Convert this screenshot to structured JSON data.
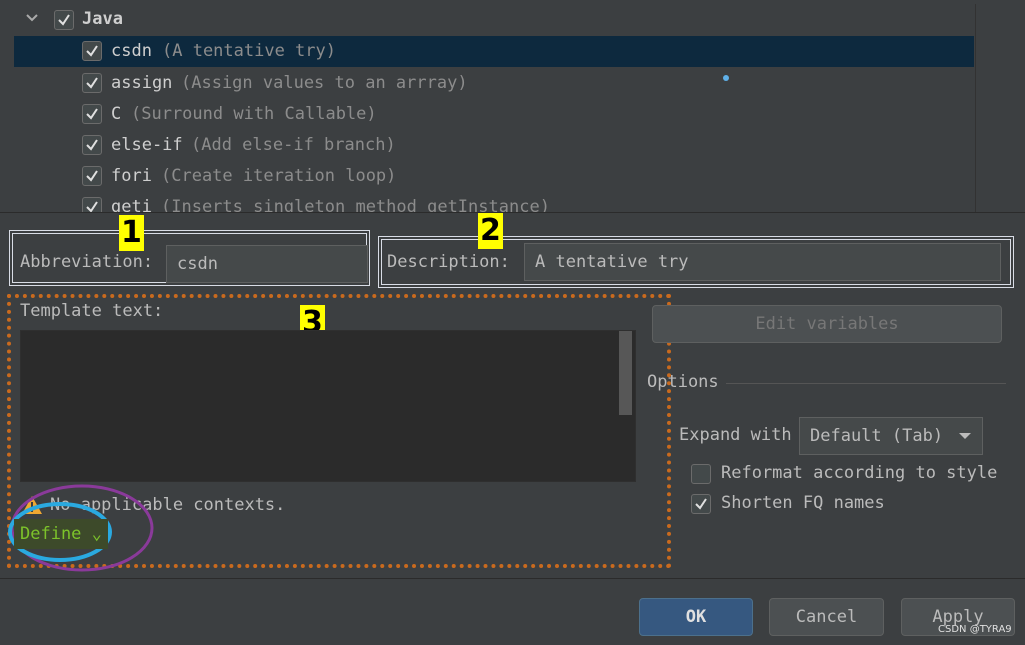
{
  "tree": {
    "group": {
      "label": "Java",
      "checked": true,
      "expanded": true
    },
    "items": [
      {
        "name": "csdn",
        "desc": "(A tentative try)",
        "checked": true,
        "selected": true
      },
      {
        "name": "assign",
        "desc": "(Assign values to an arrray)",
        "checked": true
      },
      {
        "name": "C",
        "desc": "(Surround with Callable)",
        "checked": true
      },
      {
        "name": "else-if",
        "desc": "(Add else-if branch)",
        "checked": true
      },
      {
        "name": "fori",
        "desc": "(Create iteration loop)",
        "checked": true
      },
      {
        "name": "geti",
        "desc": "(Inserts singleton method getInstance)",
        "checked": true
      }
    ]
  },
  "annotations": {
    "tag1": "1",
    "tag2": "2",
    "tag3": "3"
  },
  "abbreviation": {
    "label": "Abbreviation:",
    "value": "csdn"
  },
  "description": {
    "label": "Description:",
    "value": "A tentative try"
  },
  "template": {
    "label": "Template text:",
    "value": "",
    "warning": "No applicable contexts.",
    "define_link": "Define"
  },
  "edit_variables_label": "Edit variables",
  "options": {
    "heading": "Options",
    "expand_label": "Expand with",
    "expand_value": "Default (Tab)",
    "reformat_label": "Reformat according to style",
    "reformat_checked": false,
    "shorten_label": "Shorten FQ names",
    "shorten_checked": true
  },
  "buttons": {
    "ok": "OK",
    "cancel": "Cancel",
    "apply": "Apply"
  },
  "watermark": "CSDN @TYRA9",
  "colors": {
    "selection": "#0d293e",
    "annotation_yellow": "#ffff00",
    "annotation_orange": "#c96a1e",
    "ok_blue": "#365880"
  }
}
